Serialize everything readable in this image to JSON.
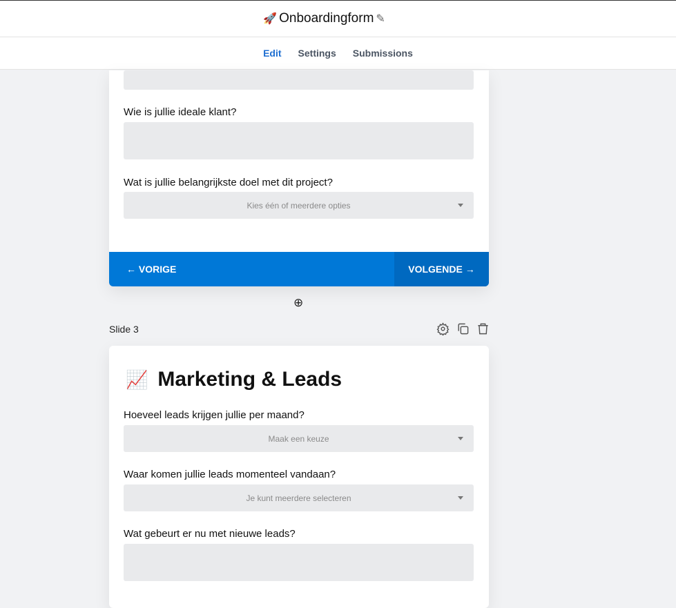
{
  "header": {
    "emoji": "🚀",
    "title": "Onboardingform",
    "edit_icon": "✎"
  },
  "tabs": [
    {
      "label": "Edit"
    },
    {
      "label": "Settings"
    },
    {
      "label": "Submissions"
    }
  ],
  "slide2": {
    "q1": "Wie is jullie ideale klant?",
    "q2": "Wat is jullie belangrijkste doel met dit project?",
    "q2_placeholder": "Kies één of meerdere opties",
    "prev": "← VORIGE",
    "next": "VOLGENDE →"
  },
  "add_slide": "⊕",
  "slide3": {
    "label": "Slide 3",
    "emoji": "📈",
    "heading": "Marketing & Leads",
    "q1": "Hoeveel leads krijgen jullie per maand?",
    "q1_placeholder": "Maak een keuze",
    "q2": "Waar komen jullie leads momenteel vandaan?",
    "q2_placeholder": "Je kunt meerdere selecteren",
    "q3": "Wat gebeurt er nu met nieuwe leads?"
  }
}
